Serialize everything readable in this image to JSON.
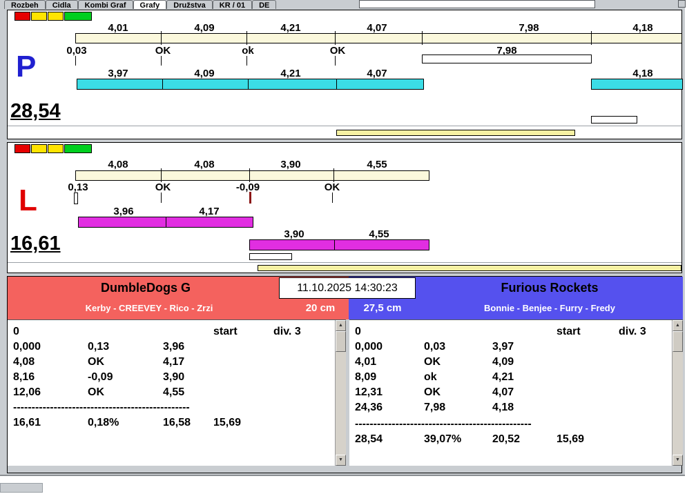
{
  "window": {
    "tabs": [
      "Rozbeh",
      "Cidla",
      "Kombi Graf",
      "Grafy",
      "Družstva",
      "KR / 01",
      "DE"
    ],
    "selected_tab": "Grafy"
  },
  "colors": {
    "lane_p_bar": "#3bdde6",
    "lane_l_bar": "#e12ee1",
    "team_left_header": "#f4625e",
    "team_right_header": "#5551ee",
    "ruler_bar": "#fbf8dc",
    "progress_bar": "#f6f1a3",
    "lane_p_letter": "#2020d0",
    "lane_l_letter": "#e00000"
  },
  "lane_p": {
    "letter": "P",
    "total": "28,54",
    "lights": [
      "red",
      "yellow",
      "yellow",
      "green"
    ],
    "splits_top": [
      "4,01",
      "4,09",
      "4,21",
      "4,07",
      "7,98",
      "4,18"
    ],
    "marks": [
      "0,03",
      "OK",
      "ok",
      "OK",
      "7,98"
    ],
    "splits_bottom": [
      "3,97",
      "4,09",
      "4,21",
      "4,07",
      "4,18"
    ]
  },
  "lane_l": {
    "letter": "L",
    "total": "16,61",
    "lights": [
      "red",
      "yellow",
      "yellow",
      "green"
    ],
    "splits_top": [
      "4,08",
      "4,08",
      "3,90",
      "4,55"
    ],
    "marks": [
      "0,13",
      "OK",
      "-0,09",
      "OK"
    ],
    "run1_splits": [
      "3,96",
      "4,17"
    ],
    "run2_splits": [
      "3,90",
      "4,55"
    ]
  },
  "clock": "11.10.2025 14:30:23",
  "teams": {
    "left": {
      "name": "DumbleDogs G",
      "members": "Kerby - CREEVEY - Rico - Zrzi",
      "jump_height": "20 cm",
      "table": {
        "header": {
          "c0": "0",
          "c3": "start",
          "c4": "div. 3"
        },
        "rows": [
          {
            "c0": "0,000",
            "c1": "0,13",
            "c2": "3,96"
          },
          {
            "c0": "4,08",
            "c1": "OK",
            "c2": "4,17"
          },
          {
            "c0": "8,16",
            "c1": "-0,09",
            "c2": "3,90"
          },
          {
            "c0": "12,06",
            "c1": "OK",
            "c2": "4,55"
          }
        ],
        "separator": "------------------------------------------------",
        "total_row": {
          "c0": "16,61",
          "c1": "0,18%",
          "c2": "16,58",
          "c3": "15,69"
        }
      }
    },
    "right": {
      "name": "Furious Rockets",
      "members": "Bonnie - Benjee - Furry - Fredy",
      "jump_height": "27,5 cm",
      "table": {
        "header": {
          "c0": "0",
          "c3": "start",
          "c4": "div. 3"
        },
        "rows": [
          {
            "c0": "0,000",
            "c1": "0,03",
            "c2": "3,97"
          },
          {
            "c0": "4,01",
            "c1": "OK",
            "c2": "4,09"
          },
          {
            "c0": "8,09",
            "c1": "ok",
            "c2": "4,21"
          },
          {
            "c0": "12,31",
            "c1": "OK",
            "c2": "4,07"
          },
          {
            "c0": "24,36",
            "c1": "7,98",
            "c2": "4,18"
          }
        ],
        "separator": "------------------------------------------------",
        "total_row": {
          "c0": "28,54",
          "c1": "39,07%",
          "c2": "20,52",
          "c3": "15,69"
        }
      }
    }
  }
}
